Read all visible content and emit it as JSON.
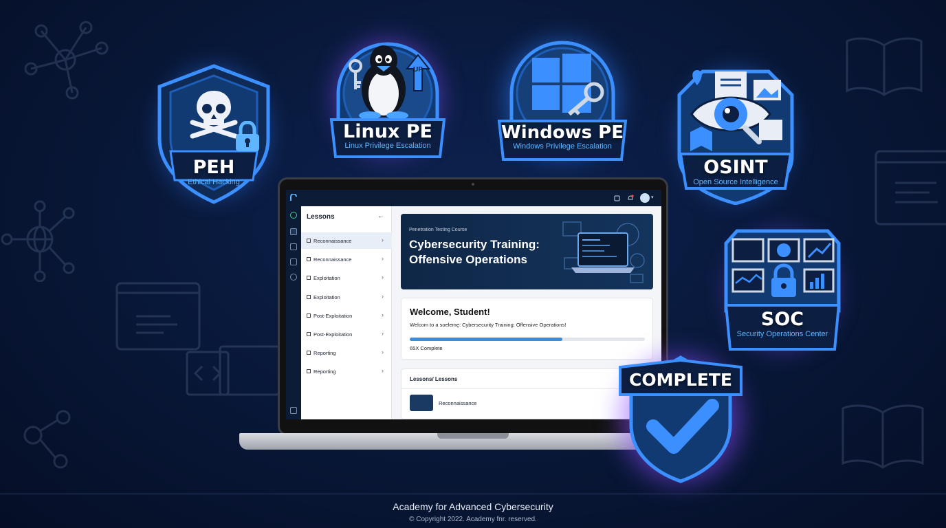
{
  "badges": {
    "peh": {
      "title": "PEH",
      "subtitle": "Ethical Hacking"
    },
    "linux": {
      "title": "Linux PE",
      "subtitle": "Linux Privilege Escalation",
      "tag": "UP"
    },
    "windows": {
      "title": "Windows PE",
      "subtitle": "Windows Privilege Escalation"
    },
    "osint": {
      "title": "OSINT",
      "subtitle": "Open Source Intelligence"
    },
    "soc": {
      "title": "SOC",
      "subtitle": "Security Operations Center"
    },
    "complete": {
      "title": "COMPLETE"
    }
  },
  "sidebar": {
    "title": "Lessons",
    "items": [
      {
        "label": "Reconnaissance"
      },
      {
        "label": "Reconnaissance"
      },
      {
        "label": "Exploitation"
      },
      {
        "label": "Exploitation"
      },
      {
        "label": "Post-Exploitation"
      },
      {
        "label": "Post-Exploitation"
      },
      {
        "label": "Reporting"
      },
      {
        "label": "Reporting"
      }
    ]
  },
  "hero": {
    "kicker": "Penetration Testing Course",
    "title": "Cybersecurity Training: Offensive Operations"
  },
  "welcome": {
    "title": "Welcome, Student!",
    "text": "Welcom to a soelemę: Cybersecurity Training: Offensive Operations!",
    "progress_percent": 65,
    "progress_label": "65X Complete"
  },
  "lesson_list": {
    "header": "Lessons/ Lessons",
    "first_item": "Reconnaissance"
  },
  "footer": {
    "title": "Academy for Advanced Cybersecurity",
    "copyright": "© Copyright 2022. Academy fnr. reserved."
  },
  "colors": {
    "background": "#081737",
    "accent": "#3d8ed8",
    "badge_glow_blue": "#2f7fff",
    "badge_glow_purple": "#8a4dff"
  }
}
